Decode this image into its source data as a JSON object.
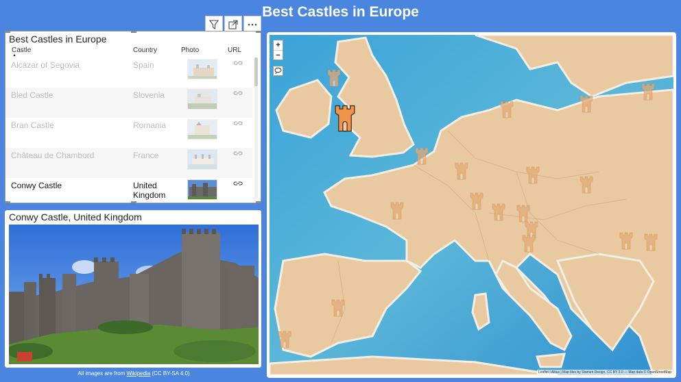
{
  "title": "Best Castles in Europe",
  "toolbar": {
    "filter_icon": "filter-icon",
    "focus_icon": "focus-mode-icon",
    "more_icon": "more-options-icon"
  },
  "table": {
    "title": "Best Castles in Europe",
    "columns": [
      "Castle",
      "Country",
      "Photo",
      "URL"
    ],
    "rows": [
      {
        "castle": "Alcázar of Segovia",
        "country": "Spain"
      },
      {
        "castle": "Bled Castle",
        "country": "Slovenia"
      },
      {
        "castle": "Bran Castle",
        "country": "Romania"
      },
      {
        "castle": "Château de Chambord",
        "country": "France"
      },
      {
        "castle": "Conwy Castle",
        "country": "United Kingdom"
      }
    ],
    "selected_row": 4
  },
  "photo": {
    "title": "Conwy Castle, United Kingdom"
  },
  "footer": {
    "prefix": "All images are from ",
    "link": "Wikipedia",
    "suffix": " (CC BY-SA 4.0)"
  },
  "map": {
    "zoom_in": "+",
    "zoom_out": "−",
    "attribution": "Leaflet | Altius | Map tiles by Stamen Design, CC BY 3.0 — Map data © OpenStreetMap",
    "colors": {
      "sea": "#4ea6d8",
      "land": "#e8c9a0",
      "marker": "#f0944a",
      "marker_faded": "#e3a874"
    }
  }
}
